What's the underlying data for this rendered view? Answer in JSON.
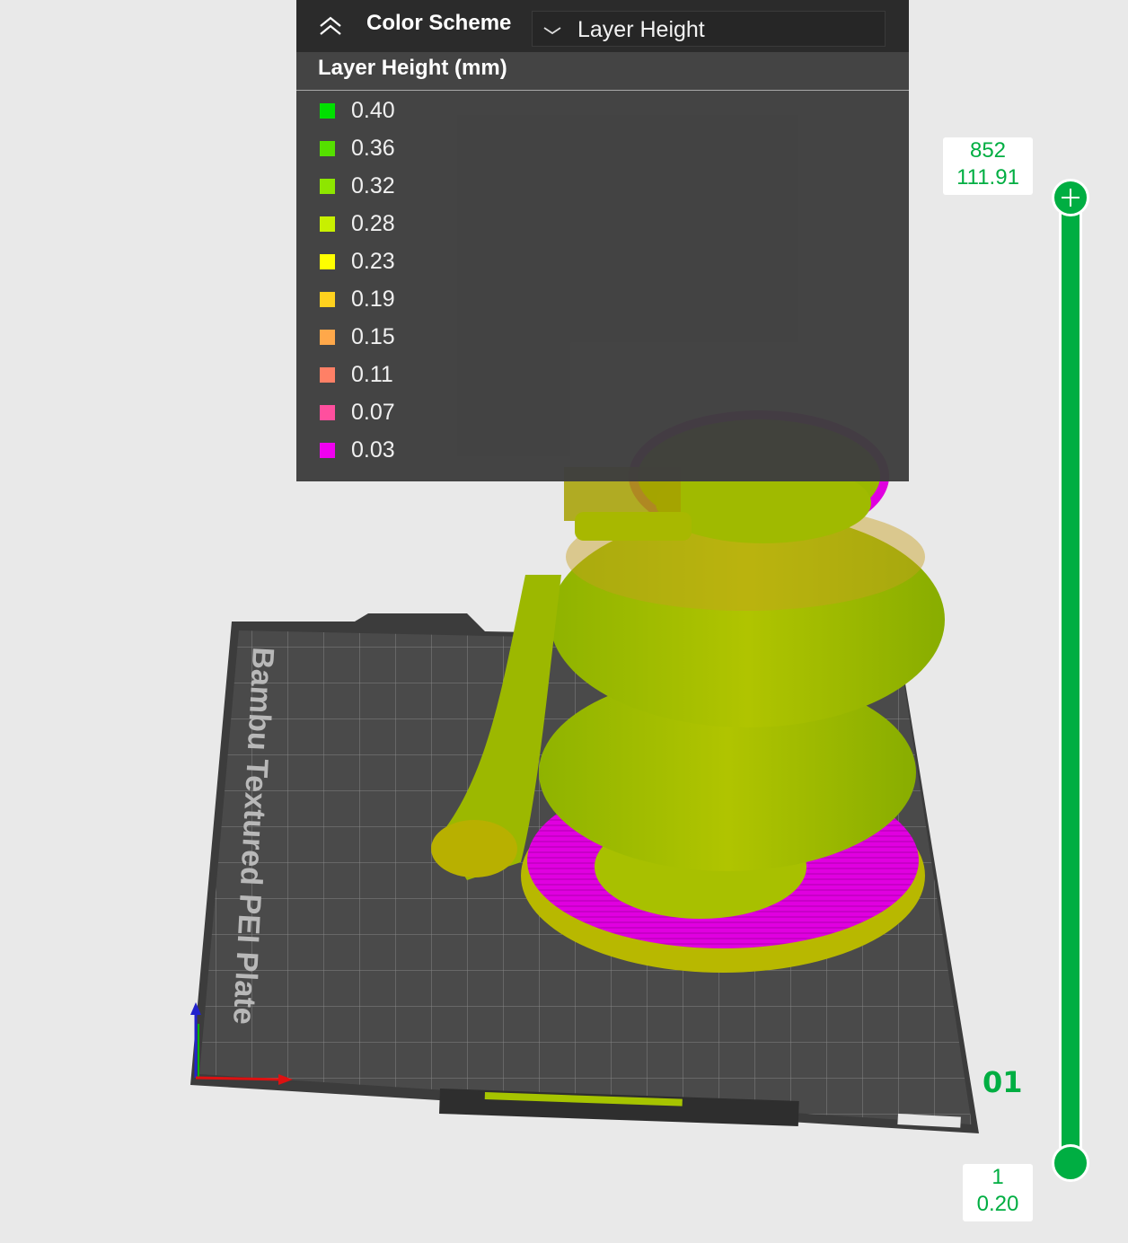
{
  "legend": {
    "scheme_label": "Color Scheme",
    "scheme_selected": "Layer Height",
    "title": "Layer Height (mm)",
    "items": [
      {
        "value": "0.40",
        "color": "#00e000"
      },
      {
        "value": "0.36",
        "color": "#55e000"
      },
      {
        "value": "0.32",
        "color": "#8ee600"
      },
      {
        "value": "0.28",
        "color": "#c8f000"
      },
      {
        "value": "0.23",
        "color": "#ffff00"
      },
      {
        "value": "0.19",
        "color": "#ffd21e"
      },
      {
        "value": "0.15",
        "color": "#ffa84a"
      },
      {
        "value": "0.11",
        "color": "#ff8066"
      },
      {
        "value": "0.07",
        "color": "#ff4f9e"
      },
      {
        "value": "0.03",
        "color": "#f000f0"
      }
    ]
  },
  "slider": {
    "top_layer": "852",
    "top_height": "111.91",
    "bottom_layer": "1",
    "bottom_height": "0.20",
    "accent": "#00ae42"
  },
  "plate": {
    "name": "Bambu Textured PEI Plate",
    "id": "01"
  }
}
